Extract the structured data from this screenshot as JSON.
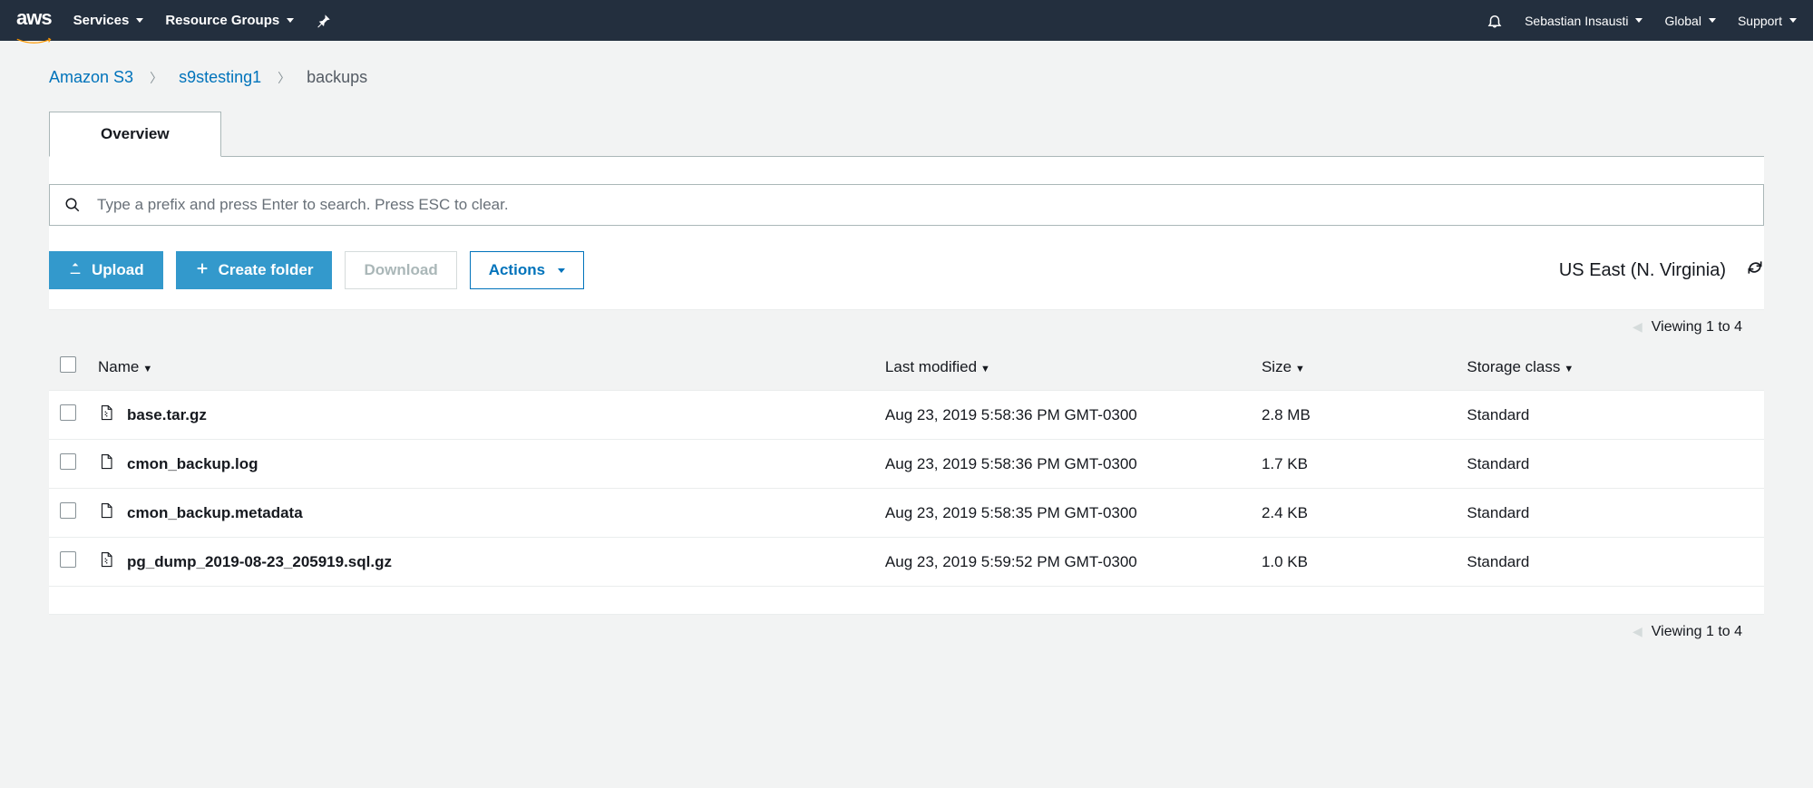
{
  "nav": {
    "services": "Services",
    "resource_groups": "Resource Groups",
    "user": "Sebastian Insausti",
    "region": "Global",
    "support": "Support"
  },
  "breadcrumb": {
    "root": "Amazon S3",
    "bucket": "s9stesting1",
    "folder": "backups"
  },
  "tabs": {
    "overview": "Overview"
  },
  "search": {
    "placeholder": "Type a prefix and press Enter to search. Press ESC to clear."
  },
  "toolbar": {
    "upload": "Upload",
    "create_folder": "Create folder",
    "download": "Download",
    "actions": "Actions",
    "region_label": "US East (N. Virginia)"
  },
  "pagination": {
    "viewing": "Viewing 1 to 4"
  },
  "columns": {
    "name": "Name",
    "last_modified": "Last modified",
    "size": "Size",
    "storage_class": "Storage class"
  },
  "objects": [
    {
      "name": "base.tar.gz",
      "icon": "archive",
      "last_modified": "Aug 23, 2019 5:58:36 PM GMT-0300",
      "size": "2.8 MB",
      "storage_class": "Standard"
    },
    {
      "name": "cmon_backup.log",
      "icon": "file",
      "last_modified": "Aug 23, 2019 5:58:36 PM GMT-0300",
      "size": "1.7 KB",
      "storage_class": "Standard"
    },
    {
      "name": "cmon_backup.metadata",
      "icon": "file",
      "last_modified": "Aug 23, 2019 5:58:35 PM GMT-0300",
      "size": "2.4 KB",
      "storage_class": "Standard"
    },
    {
      "name": "pg_dump_2019-08-23_205919.sql.gz",
      "icon": "archive",
      "last_modified": "Aug 23, 2019 5:59:52 PM GMT-0300",
      "size": "1.0 KB",
      "storage_class": "Standard"
    }
  ]
}
